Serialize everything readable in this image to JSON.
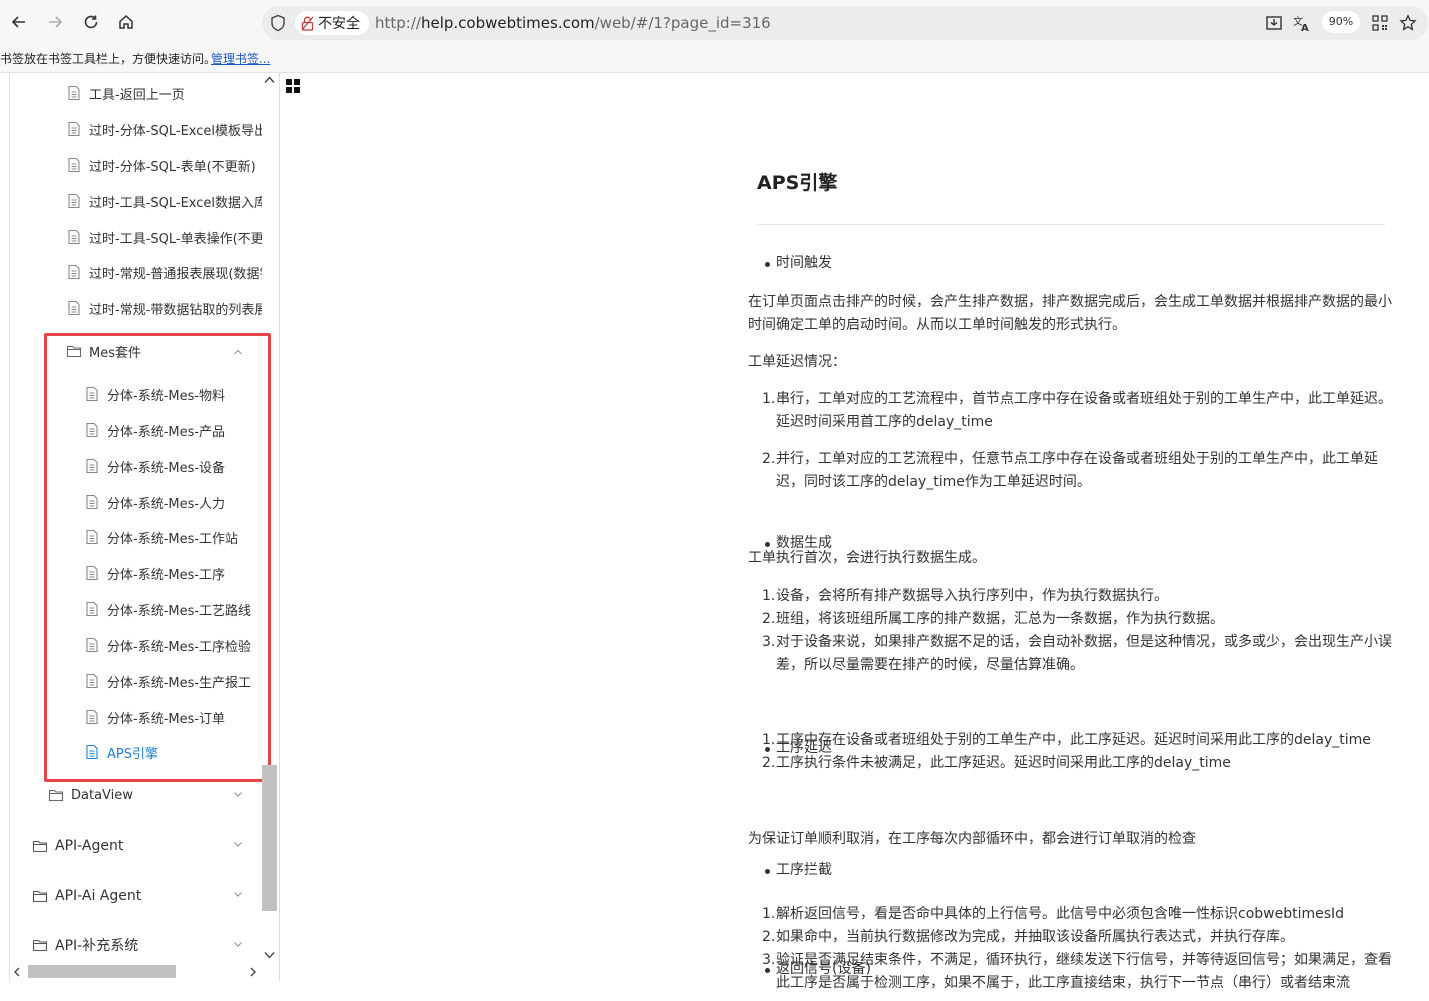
{
  "browser": {
    "security_label": "不安全",
    "url_prefix": "http://",
    "url_host": "help.cobwebtimes.com",
    "url_rest": "/web/#/1?page_id=316",
    "zoom": "90%"
  },
  "bookmarks": {
    "hint": "书签放在书签工具栏上，方便快速访问。",
    "manage_label": "管理书签..."
  },
  "sidebar": {
    "items": [
      {
        "label": "工具-返回上一页"
      },
      {
        "label": "过时-分体-SQL-Excel模板导出"
      },
      {
        "label": "过时-分体-SQL-表单(不更新)"
      },
      {
        "label": "过时-工具-SQL-Excel数据入库"
      },
      {
        "label": "过时-工具-SQL-单表操作(不更新)"
      },
      {
        "label": "过时-常规-普通报表展现(数据钻"
      },
      {
        "label": "过时-常规-带数据钻取的列表展"
      }
    ],
    "mes_folder": {
      "label": "Mes套件",
      "children": [
        {
          "label": "分体-系统-Mes-物料"
        },
        {
          "label": "分体-系统-Mes-产品"
        },
        {
          "label": "分体-系统-Mes-设备"
        },
        {
          "label": "分体-系统-Mes-人力"
        },
        {
          "label": "分体-系统-Mes-工作站"
        },
        {
          "label": "分体-系统-Mes-工序"
        },
        {
          "label": "分体-系统-Mes-工艺路线"
        },
        {
          "label": "分体-系统-Mes-工序检验"
        },
        {
          "label": "分体-系统-Mes-生产报工"
        },
        {
          "label": "分体-系统-Mes-订单"
        },
        {
          "label": "APS引擎"
        }
      ]
    },
    "dataview_label": "DataView",
    "top_folders": [
      {
        "label": "API-Agent"
      },
      {
        "label": "API-Ai Agent"
      },
      {
        "label": "API-补充系统"
      }
    ]
  },
  "article": {
    "title": "APS引擎",
    "s1_heading": "时间触发",
    "s1_para": "在订单页面点击排产的时候，会产生排产数据，排产数据完成后，会生成工单数据并根据排产数据的最小时间确定工单的启动时间。从而以工单时间触发的形式执行。",
    "s1_sub": "工单延迟情况：",
    "s1_list": [
      "串行，工单对应的工艺流程中，首节点工序中存在设备或者班组处于别的工单生产中，此工单延迟。延迟时间采用首工序的delay_time",
      "并行，工单对应的工艺流程中，任意节点工序中存在设备或者班组处于别的工单生产中，此工单延迟，同时该工序的delay_time作为工单延迟时间。"
    ],
    "s2_heading": "数据生成",
    "s2_para": "工单执行首次，会进行执行数据生成。",
    "s2_list": [
      "设备，会将所有排产数据导入执行序列中，作为执行数据执行。",
      "班组，将该班组所属工序的排产数据，汇总为一条数据，作为执行数据。",
      "对于设备来说，如果排产数据不足的话，会自动补数据，但是这种情况，或多或少，会出现生产小误差，所以尽量需要在排产的时候，尽量估算准确。"
    ],
    "s3_heading": "工序延迟",
    "s3_list": [
      "工序中存在设备或者班组处于别的工单生产中，此工序延迟。延迟时间采用此工序的delay_time",
      "工序执行条件未被满足，此工序延迟。延迟时间采用此工序的delay_time"
    ],
    "s4_heading": "工序拦截",
    "s4_para": "为保证订单顺利取消，在工序每次内部循环中，都会进行订单取消的检查",
    "s5_heading": "返回信号(设备)",
    "s5_list": [
      "解析返回信号，看是否命中具体的上行信号。此信号中必须包含唯一性标识cobwebtimesId",
      "如果命中，当前执行数据修改为完成，并抽取该设备所属执行表达式，并执行存库。",
      "验证是否满足结束条件，不满足，循环执行，继续发送下行信号，并等待返回信号；如果满足，查看此工序是否属于检测工序，如果不属于，此工序直接结束，执行下一节点（串行）或者结束流"
    ]
  },
  "colors": {
    "accent": "#1e80d6",
    "highlight_border": "#e8454b",
    "link": "#1a56c9"
  }
}
